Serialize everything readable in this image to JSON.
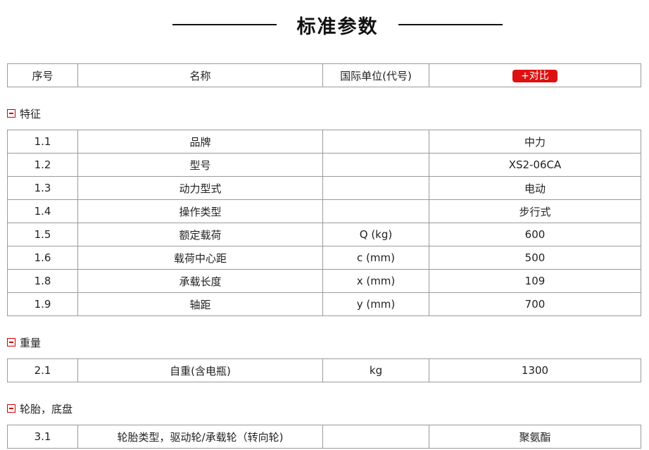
{
  "page": {
    "title": "标准参数"
  },
  "header": {
    "col_index": "序号",
    "col_name": "名称",
    "col_unit": "国际单位(代号)",
    "compare_label": "+对比"
  },
  "sections": [
    {
      "name": "特征",
      "rows": [
        {
          "index": "1.1",
          "name": "品牌",
          "unit": "",
          "value": "中力"
        },
        {
          "index": "1.2",
          "name": "型号",
          "unit": "",
          "value": "XS2-06CA"
        },
        {
          "index": "1.3",
          "name": "动力型式",
          "unit": "",
          "value": "电动"
        },
        {
          "index": "1.4",
          "name": "操作类型",
          "unit": "",
          "value": "步行式"
        },
        {
          "index": "1.5",
          "name": "额定载荷",
          "unit": "Q (kg)",
          "value": "600"
        },
        {
          "index": "1.6",
          "name": "载荷中心距",
          "unit": "c (mm)",
          "value": "500"
        },
        {
          "index": "1.8",
          "name": "承载长度",
          "unit": "x (mm)",
          "value": "109"
        },
        {
          "index": "1.9",
          "name": "轴距",
          "unit": "y (mm)",
          "value": "700"
        }
      ]
    },
    {
      "name": "重量",
      "rows": [
        {
          "index": "2.1",
          "name": "自重(含电瓶)",
          "unit": "kg",
          "value": "1300"
        }
      ]
    },
    {
      "name": "轮胎，底盘",
      "rows": [
        {
          "index": "3.1",
          "name": "轮胎类型，驱动轮/承载轮（转向轮)",
          "unit": "",
          "value": "聚氨酯"
        }
      ]
    }
  ],
  "colors": {
    "accent": "#dd1111",
    "border": "#9a9a9a",
    "toggle": "#cc0000"
  },
  "icons": {
    "section_toggle": "collapse-minus-icon"
  }
}
